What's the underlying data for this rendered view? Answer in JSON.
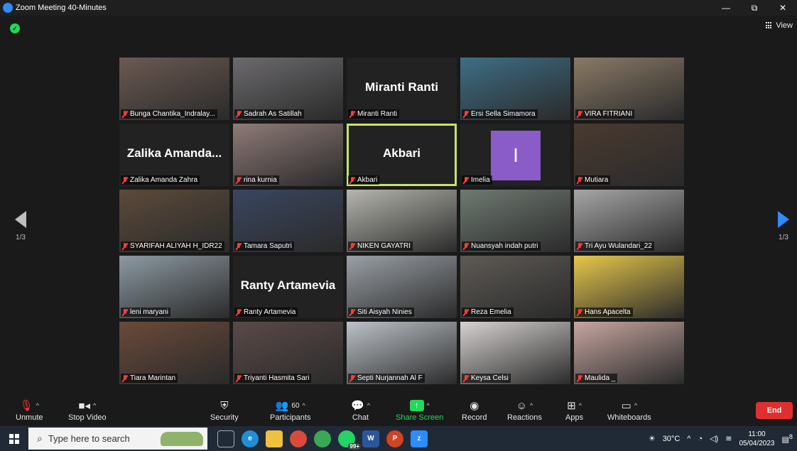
{
  "window": {
    "title": "Zoom Meeting 40-Minutes",
    "minimize": "—",
    "restore": "⧉",
    "close": "✕"
  },
  "header": {
    "view_label": "View"
  },
  "navigation": {
    "page_left": "1/3",
    "page_right": "1/3"
  },
  "participants": [
    {
      "name": "Bunga Chantika_Indralay...",
      "video": true,
      "bg": "#6b5a52"
    },
    {
      "name": "Sadrah As Satillah",
      "video": true,
      "bg": "#6c6a6d"
    },
    {
      "name": "Miranti Ranti",
      "display": "Miranti Ranti",
      "video": false
    },
    {
      "name": "Ersi Sella Simamora",
      "video": true,
      "bg": "#3e6e85"
    },
    {
      "name": "VIRA FITRIANI",
      "video": true,
      "bg": "#8a7a66"
    },
    {
      "name": "Zalika Amanda Zahra",
      "display": "Zalika  Amanda...",
      "video": false
    },
    {
      "name": "rina kurnia",
      "video": true,
      "bg": "#8f7b78"
    },
    {
      "name": "Akbari",
      "display": "Akbari",
      "video": false,
      "active": true
    },
    {
      "name": "Imelia",
      "initial": "I",
      "video": false
    },
    {
      "name": "Mutiara",
      "video": true,
      "bg": "#4a3a30"
    },
    {
      "name": "SYARIFAH ALIYAH H_IDR22",
      "video": true,
      "bg": "#5c4a3a"
    },
    {
      "name": "Tamara Saputri",
      "video": true,
      "bg": "#3a4660"
    },
    {
      "name": "NIKEN GAYATRI",
      "video": true,
      "bg": "#b6b6ae"
    },
    {
      "name": "Nuansyah indah putri",
      "video": true,
      "bg": "#6f7a72"
    },
    {
      "name": "Tri Ayu Wulandari_22",
      "video": true,
      "bg": "#a7a6a6"
    },
    {
      "name": "leni maryani",
      "video": true,
      "bg": "#8d9aa3"
    },
    {
      "name": "Ranty Artamevia",
      "display": "Ranty Artamevia",
      "video": false
    },
    {
      "name": "Siti Aisyah Ninies",
      "video": true,
      "bg": "#9aa0a6"
    },
    {
      "name": "Reza Emelia",
      "video": true,
      "bg": "#5e5a55"
    },
    {
      "name": "Hans Apacelta",
      "video": true,
      "bg": "#e6c84a"
    },
    {
      "name": "Tiara Marintan",
      "video": true,
      "bg": "#6a4a3a"
    },
    {
      "name": "Triyanti Hasmita Sari",
      "video": true,
      "bg": "#5a4a48"
    },
    {
      "name": "Septi Nurjannah Al F",
      "video": true,
      "bg": "#bcc2c8"
    },
    {
      "name": "Keysa Celsi",
      "video": true,
      "bg": "#d6d2d0"
    },
    {
      "name": "Maulida _",
      "video": true,
      "bg": "#c7a6a0"
    }
  ],
  "toolbar": {
    "unmute": "Unmute",
    "stop_video": "Stop Video",
    "security": "Security",
    "participants": "Participants",
    "participants_count": "60",
    "chat": "Chat",
    "share_screen": "Share Screen",
    "record": "Record",
    "reactions": "Reactions",
    "apps": "Apps",
    "whiteboards": "Whiteboards",
    "end": "End"
  },
  "taskbar": {
    "search_placeholder": "Type here to search",
    "whatsapp_badge": "99+",
    "temperature": "30°C",
    "time": "11:00",
    "date": "05/04/2023",
    "notifications": "8"
  },
  "colors": {
    "accent": "#2d8cff",
    "share_green": "#23d959",
    "end_red": "#e02f2f",
    "active_speaker": "#c8e36a"
  }
}
